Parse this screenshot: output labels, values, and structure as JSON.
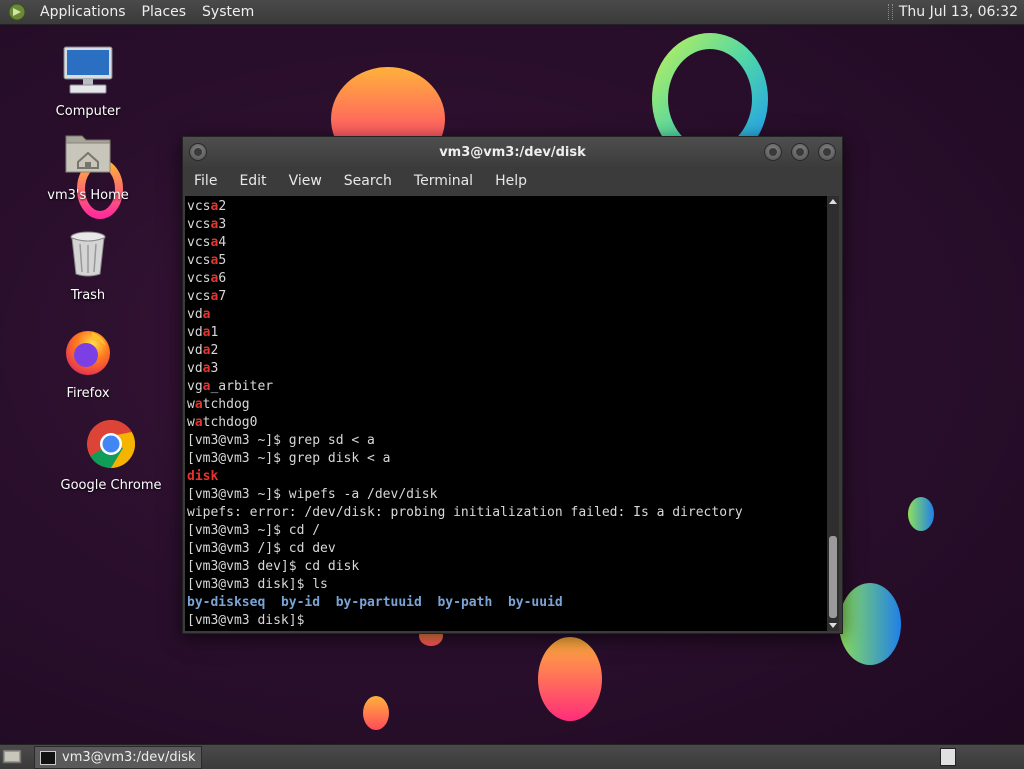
{
  "top_panel": {
    "menus": [
      "Applications",
      "Places",
      "System"
    ],
    "clock": "Thu Jul 13, 06:32"
  },
  "desktop_icons": [
    {
      "label": "Computer",
      "icon": "computer-icon"
    },
    {
      "label": "vm3's Home",
      "icon": "home-folder-icon"
    },
    {
      "label": "Trash",
      "icon": "trash-icon"
    },
    {
      "label": "Firefox",
      "icon": "firefox-icon"
    },
    {
      "label": "Google Chrome",
      "icon": "chrome-icon"
    }
  ],
  "terminal": {
    "title": "vm3@vm3:/dev/disk",
    "menus": [
      "File",
      "Edit",
      "View",
      "Search",
      "Terminal",
      "Help"
    ],
    "lines": [
      [
        {
          "t": "vcs"
        },
        {
          "t": "a",
          "c": "hl"
        },
        {
          "t": "2"
        }
      ],
      [
        {
          "t": "vcs"
        },
        {
          "t": "a",
          "c": "hl"
        },
        {
          "t": "3"
        }
      ],
      [
        {
          "t": "vcs"
        },
        {
          "t": "a",
          "c": "hl"
        },
        {
          "t": "4"
        }
      ],
      [
        {
          "t": "vcs"
        },
        {
          "t": "a",
          "c": "hl"
        },
        {
          "t": "5"
        }
      ],
      [
        {
          "t": "vcs"
        },
        {
          "t": "a",
          "c": "hl"
        },
        {
          "t": "6"
        }
      ],
      [
        {
          "t": "vcs"
        },
        {
          "t": "a",
          "c": "hl"
        },
        {
          "t": "7"
        }
      ],
      [
        {
          "t": "vd"
        },
        {
          "t": "a",
          "c": "hl"
        }
      ],
      [
        {
          "t": "vd"
        },
        {
          "t": "a",
          "c": "hl"
        },
        {
          "t": "1"
        }
      ],
      [
        {
          "t": "vd"
        },
        {
          "t": "a",
          "c": "hl"
        },
        {
          "t": "2"
        }
      ],
      [
        {
          "t": "vd"
        },
        {
          "t": "a",
          "c": "hl"
        },
        {
          "t": "3"
        }
      ],
      [
        {
          "t": "vg"
        },
        {
          "t": "a",
          "c": "hl"
        },
        {
          "t": "_arbiter"
        }
      ],
      [
        {
          "t": "w"
        },
        {
          "t": "a",
          "c": "hl"
        },
        {
          "t": "tchdog"
        }
      ],
      [
        {
          "t": "w"
        },
        {
          "t": "a",
          "c": "hl"
        },
        {
          "t": "tchdog0"
        }
      ],
      [
        {
          "t": "[vm3@vm3 ~]$ grep sd < a"
        }
      ],
      [
        {
          "t": "[vm3@vm3 ~]$ grep disk < a"
        }
      ],
      [
        {
          "t": "disk",
          "c": "hl"
        }
      ],
      [
        {
          "t": "[vm3@vm3 ~]$ wipefs -a /dev/disk"
        }
      ],
      [
        {
          "t": "wipefs: error: /dev/disk: probing initialization failed: Is a directory"
        }
      ],
      [
        {
          "t": "[vm3@vm3 ~]$ cd /"
        }
      ],
      [
        {
          "t": "[vm3@vm3 /]$ cd dev"
        }
      ],
      [
        {
          "t": "[vm3@vm3 dev]$ cd disk"
        }
      ],
      [
        {
          "t": "[vm3@vm3 disk]$ ls"
        }
      ],
      [
        {
          "t": "by-diskseq",
          "c": "dir"
        },
        {
          "t": "  "
        },
        {
          "t": "by-id",
          "c": "dir"
        },
        {
          "t": "  "
        },
        {
          "t": "by-partuuid",
          "c": "dir"
        },
        {
          "t": "  "
        },
        {
          "t": "by-path",
          "c": "dir"
        },
        {
          "t": "  "
        },
        {
          "t": "by-uuid",
          "c": "dir"
        }
      ],
      [
        {
          "t": "[vm3@vm3 disk]$ "
        }
      ]
    ]
  },
  "taskbar": {
    "tasks": [
      {
        "label": "vm3@vm3:/dev/disk",
        "icon": "terminal-icon"
      }
    ]
  },
  "colors": {
    "highlight": "#e8322c",
    "directory": "#7aa3d6",
    "terminal_text": "#d8d8d8"
  }
}
